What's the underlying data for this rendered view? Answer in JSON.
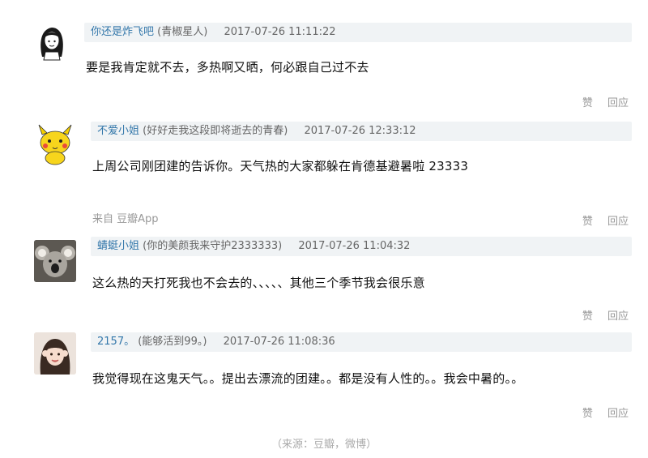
{
  "comments": [
    {
      "author": "你还是炸飞吧",
      "signature": "(青椒星人)",
      "time": "2017-07-26 11:11:22",
      "text": "要是我肯定就不去，多热啊又晒，何必跟自己过不去",
      "source": "",
      "like_label": "赞",
      "reply_label": "回应",
      "avatar_icon": "girl-cartoon-avatar"
    },
    {
      "author": "不爱小姐",
      "signature": "(好好走我这段即将逝去的青春)",
      "time": "2017-07-26 12:33:12",
      "text": "上周公司刚团建的告诉你。天气热的大家都躲在肯德基避暑啦 23333",
      "source": "来自 豆瓣App",
      "like_label": "赞",
      "reply_label": "回应",
      "avatar_icon": "pikachu-avatar"
    },
    {
      "author": "蜻蜓小姐",
      "signature": "(你的美颜我来守护2333333)",
      "time": "2017-07-26 11:04:32",
      "text": "这么热的天打死我也不会去的、、、、、其他三个季节我会很乐意",
      "source": "",
      "like_label": "赞",
      "reply_label": "回应",
      "avatar_icon": "koala-avatar"
    },
    {
      "author": "2157。",
      "signature": "(能够活到99。)",
      "time": "2017-07-26 11:08:36",
      "text": "我觉得现在这鬼天气。。提出去漂流的团建。。都是没有人性的。。我会中暑的。。",
      "source": "",
      "like_label": "赞",
      "reply_label": "回应",
      "avatar_icon": "girl-photo-avatar"
    }
  ],
  "caption": "（来源：豆瓣，微博）",
  "colors": {
    "author": "#3377aa",
    "header_bg": "#f0f3f5",
    "muted": "#999999"
  }
}
